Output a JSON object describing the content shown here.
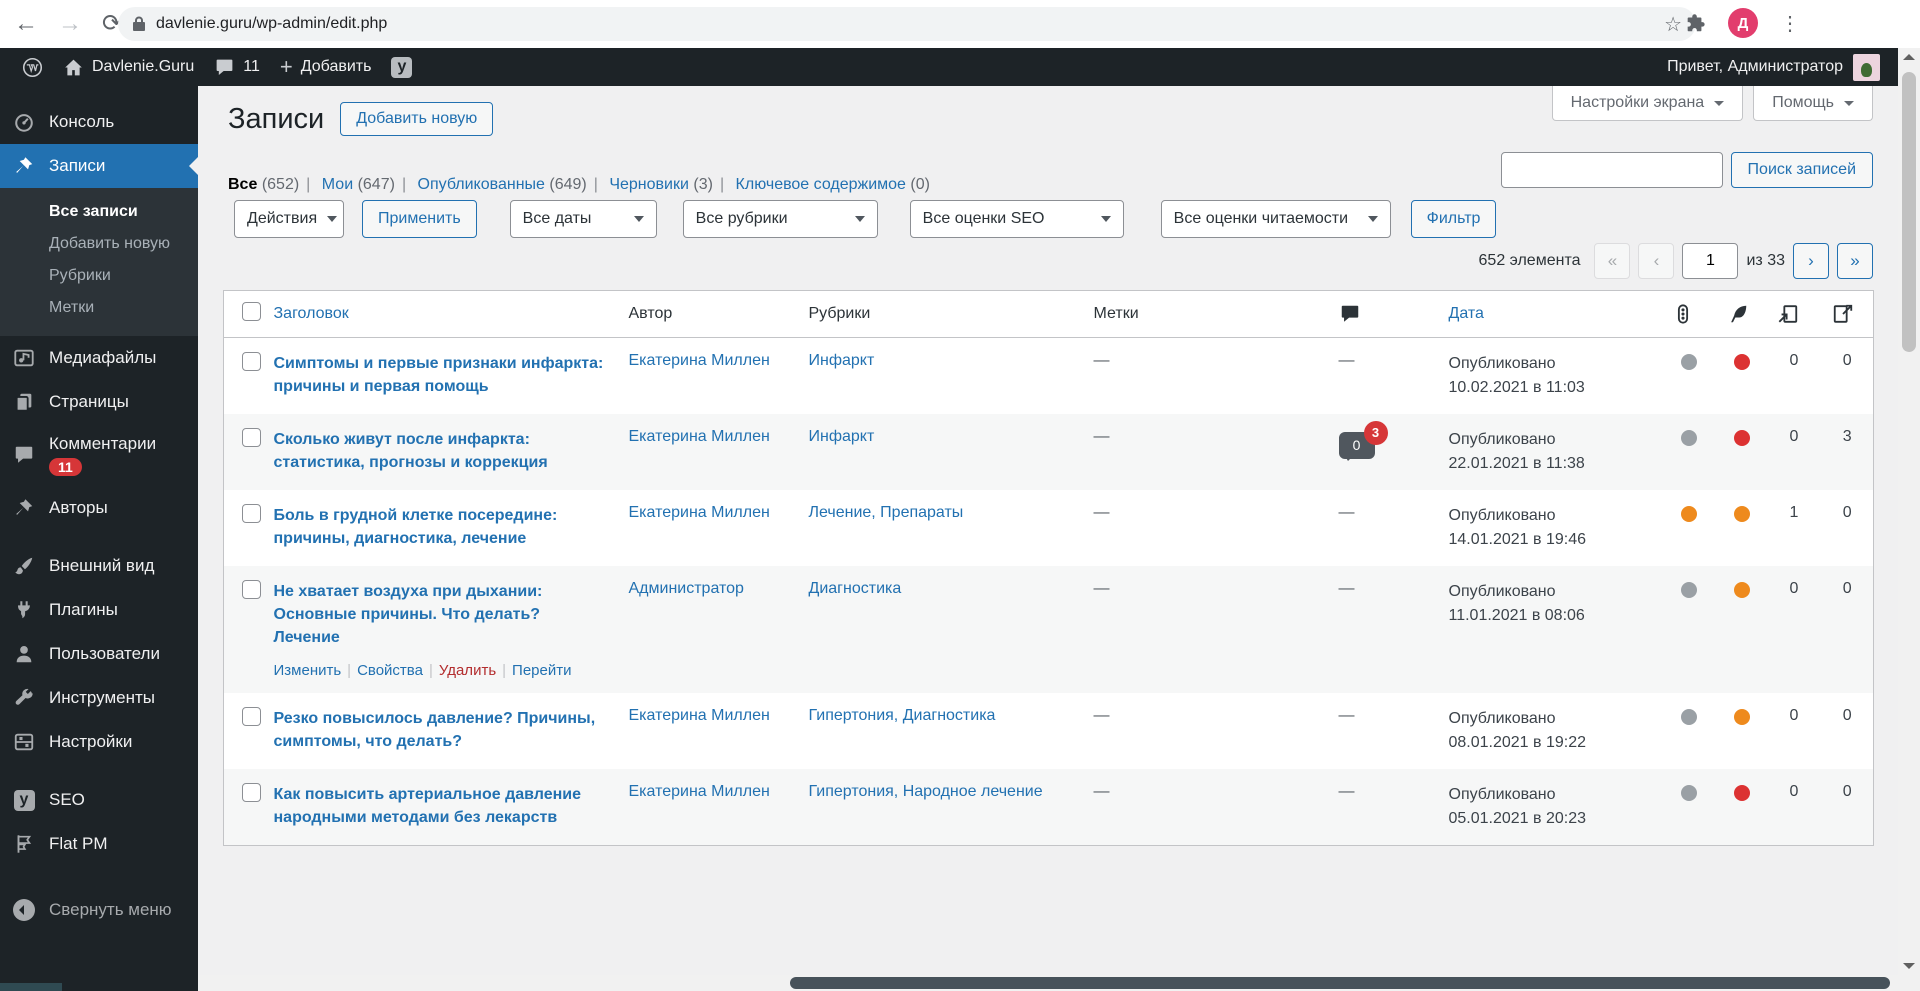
{
  "colors": {
    "accent": "#2271b1",
    "badge": "#d63638",
    "dots": {
      "gray": "#9aa0a5",
      "orange": "#ee8a1d",
      "red": "#dc3232"
    }
  },
  "glyphs": {
    "back": "←",
    "forward": "→",
    "reload": "⟳",
    "star": "☆",
    "menu_dots": "⋮",
    "plus": "+",
    "yoast_letter": "y",
    "pg_first": "«",
    "pg_prev": "‹",
    "pg_next": "›",
    "pg_last": "»"
  },
  "browser": {
    "url": "davlenie.guru/wp-admin/edit.php",
    "avatar_initial": "Д"
  },
  "admin_bar": {
    "site_name": "Davlenie.Guru",
    "comments_count": "11",
    "new_label": "Добавить",
    "greeting": "Привет, Администратор"
  },
  "sidebar": {
    "items": [
      {
        "label": "Консоль"
      },
      {
        "label": "Записи"
      },
      {
        "label": "Медиафайлы"
      },
      {
        "label": "Страницы"
      },
      {
        "label": "Комментарии",
        "badge": "11"
      },
      {
        "label": "Авторы"
      },
      {
        "label": "Внешний вид"
      },
      {
        "label": "Плагины"
      },
      {
        "label": "Пользователи"
      },
      {
        "label": "Инструменты"
      },
      {
        "label": "Настройки"
      },
      {
        "label": "SEO"
      },
      {
        "label": "Flat PM"
      }
    ],
    "submenu": [
      {
        "label": "Все записи"
      },
      {
        "label": "Добавить новую"
      },
      {
        "label": "Рубрики"
      },
      {
        "label": "Метки"
      }
    ],
    "collapse": "Свернуть меню"
  },
  "page": {
    "title": "Записи",
    "add_new": "Добавить новую",
    "screen_options": "Настройки экрана",
    "help": "Помощь",
    "views": [
      {
        "label": "Все",
        "count": "(652)"
      },
      {
        "label": "Мои",
        "count": "(647)"
      },
      {
        "label": "Опубликованные",
        "count": "(649)"
      },
      {
        "label": "Черновики",
        "count": "(3)"
      },
      {
        "label": "Ключевое содержимое",
        "count": "(0)"
      }
    ],
    "search_button": "Поиск записей",
    "bulk_action": "Действия",
    "apply": "Применить",
    "filter_dates": "Все даты",
    "filter_categories": "Все рубрики",
    "filter_seo": "Все оценки SEO",
    "filter_readability": "Все оценки читаемости",
    "filter_button": "Фильтр",
    "pagination": {
      "total": "652 элемента",
      "current": "1",
      "of": "из 33"
    }
  },
  "table": {
    "headers": {
      "title": "Заголовок",
      "author": "Автор",
      "categories": "Рубрики",
      "tags": "Метки",
      "date": "Дата"
    },
    "rows": [
      {
        "title": "Симптомы и первые признаки инфаркта: причины и первая помощь",
        "author": "Екатерина Миллен",
        "categories": "Инфаркт",
        "tags": "—",
        "comments": "—",
        "date_line1": "Опубликовано",
        "date_line2": "10.02.2021 в 11:03",
        "seo": "gray",
        "readability": "red",
        "links_in": "0",
        "links_out": "0"
      },
      {
        "title": "Сколько живут после инфаркта: статистика, прогнозы и коррекция",
        "author": "Екатерина Миллен",
        "categories": "Инфаркт",
        "tags": "—",
        "comments_approved": "0",
        "comments_pending": "3",
        "date_line1": "Опубликовано",
        "date_line2": "22.01.2021 в 11:38",
        "seo": "gray",
        "readability": "red",
        "links_in": "0",
        "links_out": "3"
      },
      {
        "title": "Боль в грудной клетке посередине: причины, диагностика, лечение",
        "author": "Екатерина Миллен",
        "categories": "Лечение, Препараты",
        "tags": "—",
        "comments": "—",
        "date_line1": "Опубликовано",
        "date_line2": "14.01.2021 в 19:46",
        "seo": "orange",
        "readability": "orange",
        "links_in": "1",
        "links_out": "0"
      },
      {
        "title": "Не хватает воздуха при дыхании: Основные причины. Что делать? Лечение",
        "author": "Администратор",
        "categories": "Диагностика",
        "tags": "—",
        "comments": "—",
        "date_line1": "Опубликовано",
        "date_line2": "11.01.2021 в 08:06",
        "seo": "gray",
        "readability": "orange",
        "links_in": "0",
        "links_out": "0",
        "actions": {
          "edit": "Изменить",
          "quick": "Свойства",
          "trash": "Удалить",
          "view": "Перейти"
        }
      },
      {
        "title": "Резко повысилось давление? Причины, симптомы, что делать?",
        "author": "Екатерина Миллен",
        "categories": "Гипертония, Диагностика",
        "tags": "—",
        "comments": "—",
        "date_line1": "Опубликовано",
        "date_line2": "08.01.2021 в 19:22",
        "seo": "gray",
        "readability": "orange",
        "links_in": "0",
        "links_out": "0"
      },
      {
        "title": "Как повысить артериальное давление народными методами без лекарств",
        "author": "Екатерина Миллен",
        "categories": "Гипертония, Народное лечение",
        "tags": "—",
        "comments": "—",
        "date_line1": "Опубликовано",
        "date_line2": "05.01.2021 в 20:23",
        "seo": "gray",
        "readability": "red",
        "links_in": "0",
        "links_out": "0"
      }
    ]
  }
}
